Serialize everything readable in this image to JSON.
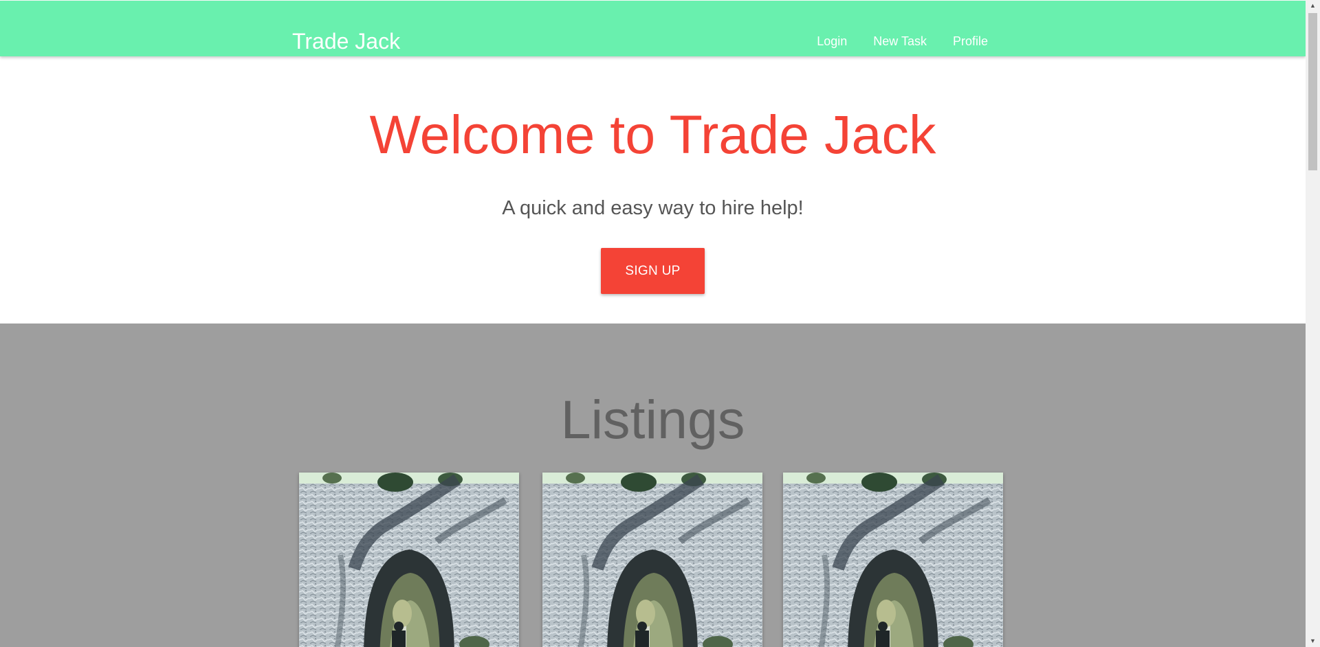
{
  "navbar": {
    "brand": "Trade Jack",
    "links": [
      {
        "label": "Login"
      },
      {
        "label": "New Task"
      },
      {
        "label": "Profile"
      }
    ],
    "color": "#69f0ae"
  },
  "hero": {
    "title": "Welcome to Trade Jack",
    "subtitle": "A quick and easy way to hire help!",
    "signup_label": "SIGN UP",
    "accent_color": "#f44336"
  },
  "listings": {
    "title": "Listings",
    "background": "#9e9e9e",
    "cards": [
      {
        "image": "rock-arch-photo"
      },
      {
        "image": "rock-arch-photo"
      },
      {
        "image": "rock-arch-photo"
      }
    ]
  },
  "scrollbar": {
    "up_icon": "triangle-up-icon",
    "down_icon": "triangle-down-icon"
  }
}
